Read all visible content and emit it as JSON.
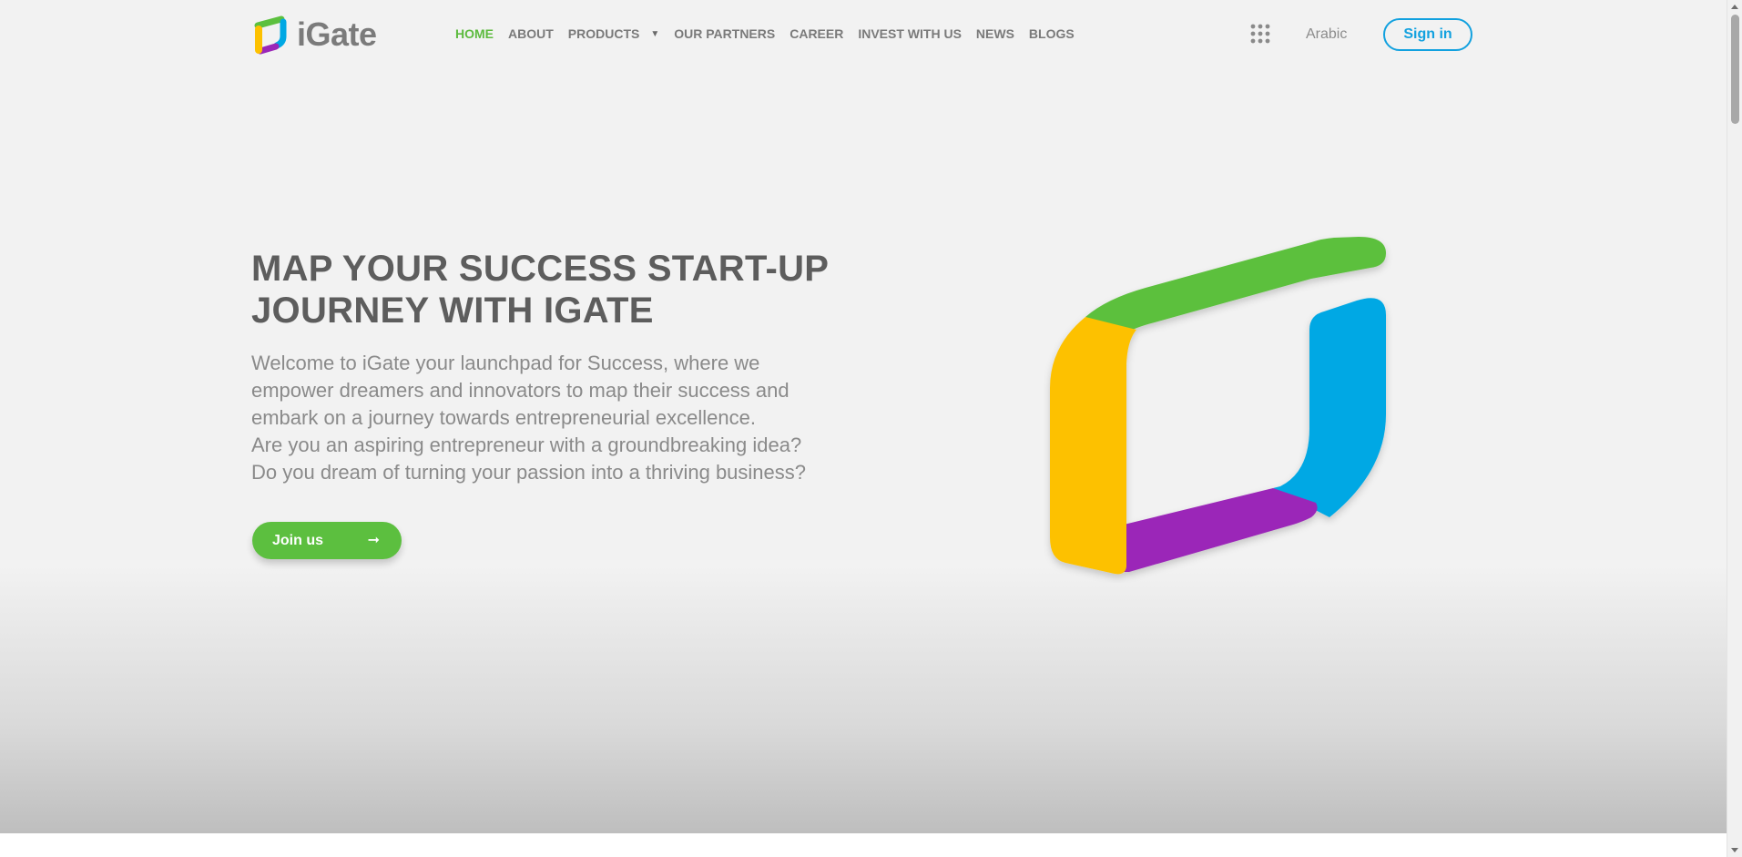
{
  "brand": {
    "name": "iGate"
  },
  "nav": {
    "items": [
      {
        "label": "HOME",
        "active": true
      },
      {
        "label": "ABOUT",
        "active": false
      },
      {
        "label": "PRODUCTS",
        "active": false,
        "has_dropdown": true
      },
      {
        "label": "OUR PARTNERS",
        "active": false
      },
      {
        "label": "CAREER",
        "active": false
      },
      {
        "label": "INVEST WITH US",
        "active": false
      },
      {
        "label": "NEWS",
        "active": false
      },
      {
        "label": "BLOGS",
        "active": false
      }
    ],
    "apps_icon": "grid-dots-icon",
    "language_label": "Arabic",
    "signin_label": "Sign in"
  },
  "hero": {
    "title_line1": "MAP YOUR SUCCESS START-UP",
    "title_line2": "JOURNEY WITH IGATE",
    "text_lines": [
      "Welcome to iGate your launchpad for Success, where we",
      "empower dreamers and innovators to map their success and",
      "embark on a journey towards entrepreneurial excellence.",
      "Are you an aspiring entrepreneur with a groundbreaking idea?",
      "Do you dream of turning your passion into a thriving business?"
    ],
    "cta_label": "Join us",
    "cta_icon": "arrow-right-icon"
  },
  "colors": {
    "accent_green": "#5cbf3f",
    "accent_blue": "#12a1df",
    "logo_yellow": "#fdc100",
    "logo_purple": "#9b27b8",
    "logo_blue": "#00a8e4",
    "logo_green": "#5cc03e",
    "title_gray": "#5d5d5d",
    "text_gray": "#8a8a8a"
  }
}
